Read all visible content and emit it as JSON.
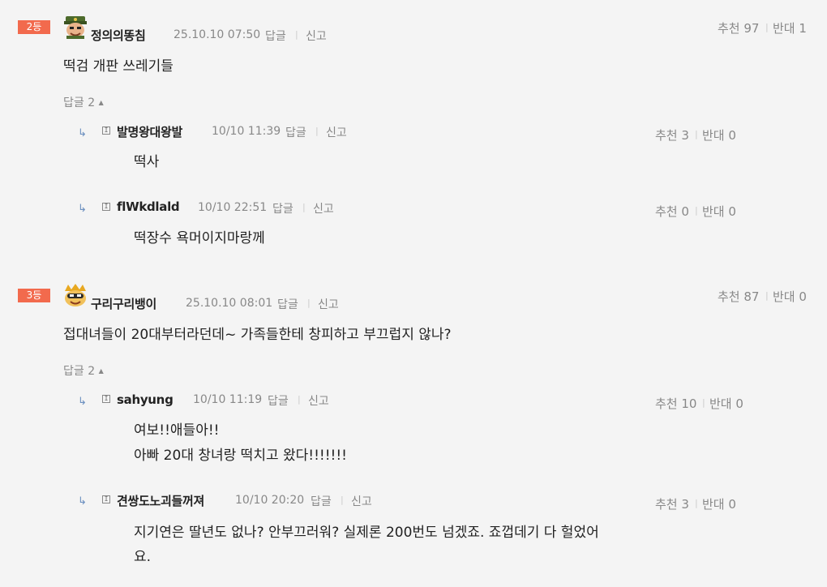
{
  "labels": {
    "reply": "답글",
    "report": "신고",
    "sep": "|",
    "reply_arrow": "↳",
    "rb_mark": "I"
  },
  "comments": [
    {
      "rank": "2등",
      "nick": "정의의똥침",
      "date": "25.10.10 07:50",
      "up": "추천 97",
      "down": "반대 1",
      "body": "떡검 개판 쓰레기들",
      "replies_toggle": "답글 2",
      "replies": [
        {
          "nick": "발명왕대왕발",
          "date": "10/10 11:39",
          "up": "추천 3",
          "down": "반대 0",
          "body": [
            "떡사"
          ]
        },
        {
          "nick": "flWkdlald",
          "date": "10/10 22:51",
          "up": "추천 0",
          "down": "반대 0",
          "body": [
            "떡장수 욕머이지마랑께"
          ]
        }
      ]
    },
    {
      "rank": "3등",
      "nick": "구리구리뱅이",
      "date": "25.10.10 08:01",
      "up": "추천 87",
      "down": "반대 0",
      "body": "접대녀들이 20대부터라던데~ 가족들한테 창피하고 부끄럽지 않나?",
      "replies_toggle": "답글 2",
      "replies": [
        {
          "nick": "sahyung",
          "date": "10/10 11:19",
          "up": "추천 10",
          "down": "반대 0",
          "body": [
            "여보!!애들아!!",
            "아빠 20대 창녀랑 떡치고 왔다!!!!!!!"
          ]
        },
        {
          "nick": "견쌍도노괴들꺼져",
          "date": "10/10 20:20",
          "up": "추천 3",
          "down": "반대 0",
          "body": [
            "지기연은 딸년도 없나? 안부끄러워? 실제론 200번도 넘겠죠. 죠껍데기 다 헐었어",
            "요."
          ]
        }
      ]
    }
  ]
}
